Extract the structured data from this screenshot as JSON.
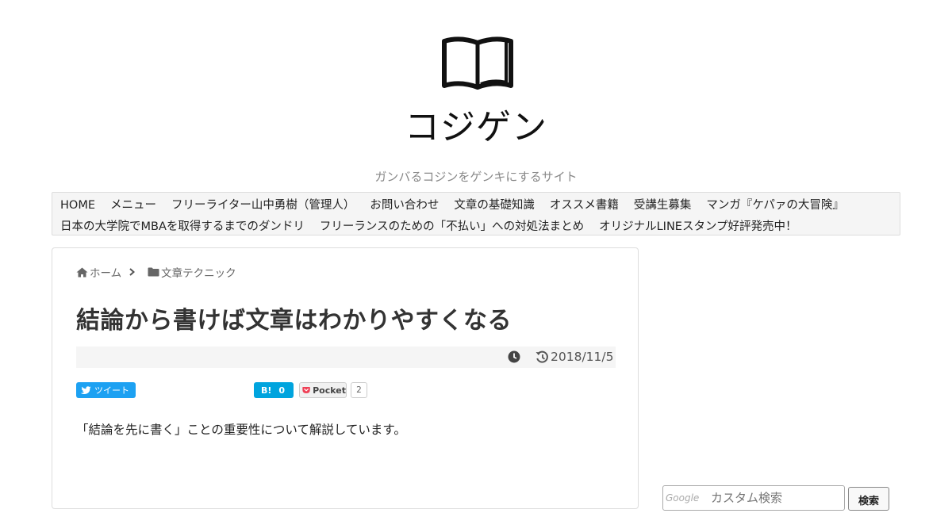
{
  "site": {
    "title": "コジゲン",
    "tagline": "ガンバるコジンをゲンキにするサイト"
  },
  "nav": {
    "items": [
      "HOME",
      "メニュー",
      "フリーライター山中勇樹（管理人）",
      "お問い合わせ",
      "文章の基礎知識",
      "オススメ書籍",
      "受講生募集",
      "マンガ『ケパァの大冒険』",
      "日本の大学院でMBAを取得するまでのダンドリ",
      "フリーランスのための「不払い」への対処法まとめ",
      "オリジナルLINEスタンプ好評発売中！"
    ]
  },
  "breadcrumb": {
    "home": "ホーム",
    "category": "文章テクニック"
  },
  "article": {
    "title": "結論から書けば文章はわかりやすくなる",
    "updated_date": "2018/11/5",
    "excerpt": "「結論を先に書く」ことの重要性について解説しています。"
  },
  "share": {
    "tweet_label": "ツイート",
    "hatena_count": "0",
    "pocket_label": "Pocket",
    "pocket_count": "2"
  },
  "search": {
    "placeholder": "カスタム検索",
    "google_label": "Google",
    "button_label": "検索"
  },
  "icons": {
    "logo": "open-book-icon",
    "home": "home-icon",
    "category": "folder-icon",
    "published": "clock-icon",
    "updated": "history-icon"
  },
  "colors": {
    "twitter": "#1da1f2",
    "hatena": "#00a4de",
    "pocket": "#ef4056"
  }
}
